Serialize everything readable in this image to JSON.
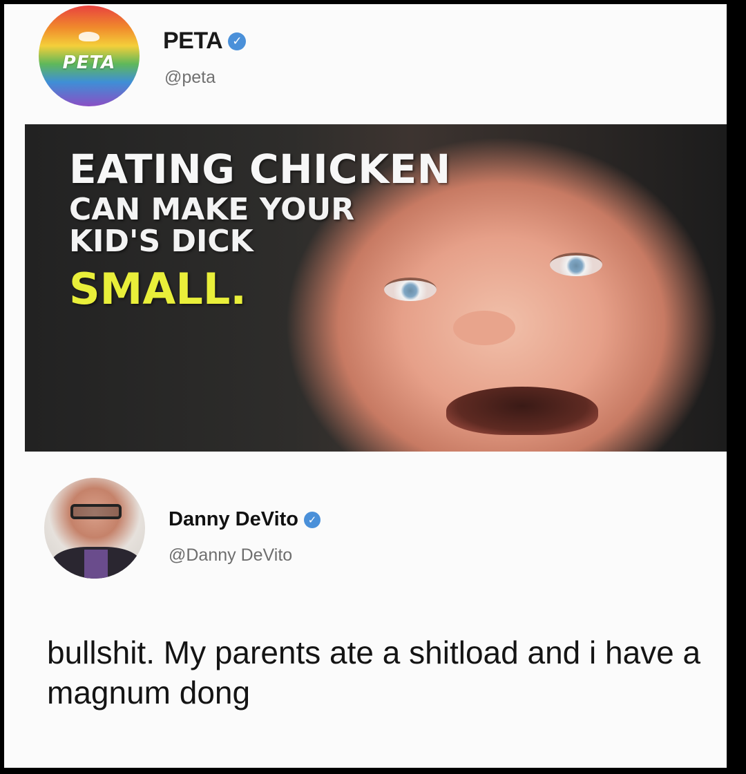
{
  "peta_tweet": {
    "avatar_logo_text": "PETA",
    "display_name": "PETA",
    "handle": "@peta",
    "verified": true,
    "image_text": {
      "line1": "EATING CHICKEN",
      "line2": "CAN MAKE YOUR",
      "line3": "KID'S DICK",
      "line4": "SMALL."
    }
  },
  "reply_tweet": {
    "display_name": "Danny DeVito",
    "handle": "@Danny DeVito",
    "verified": true,
    "text": "bullshit. My parents ate a shitload and i have a magnum dong"
  },
  "colors": {
    "verified_badge": "#4a90d9",
    "highlight_text": "#e9ef3a",
    "card_background": "#fbfbfb"
  },
  "icons": {
    "verified": "check-badge-icon"
  }
}
